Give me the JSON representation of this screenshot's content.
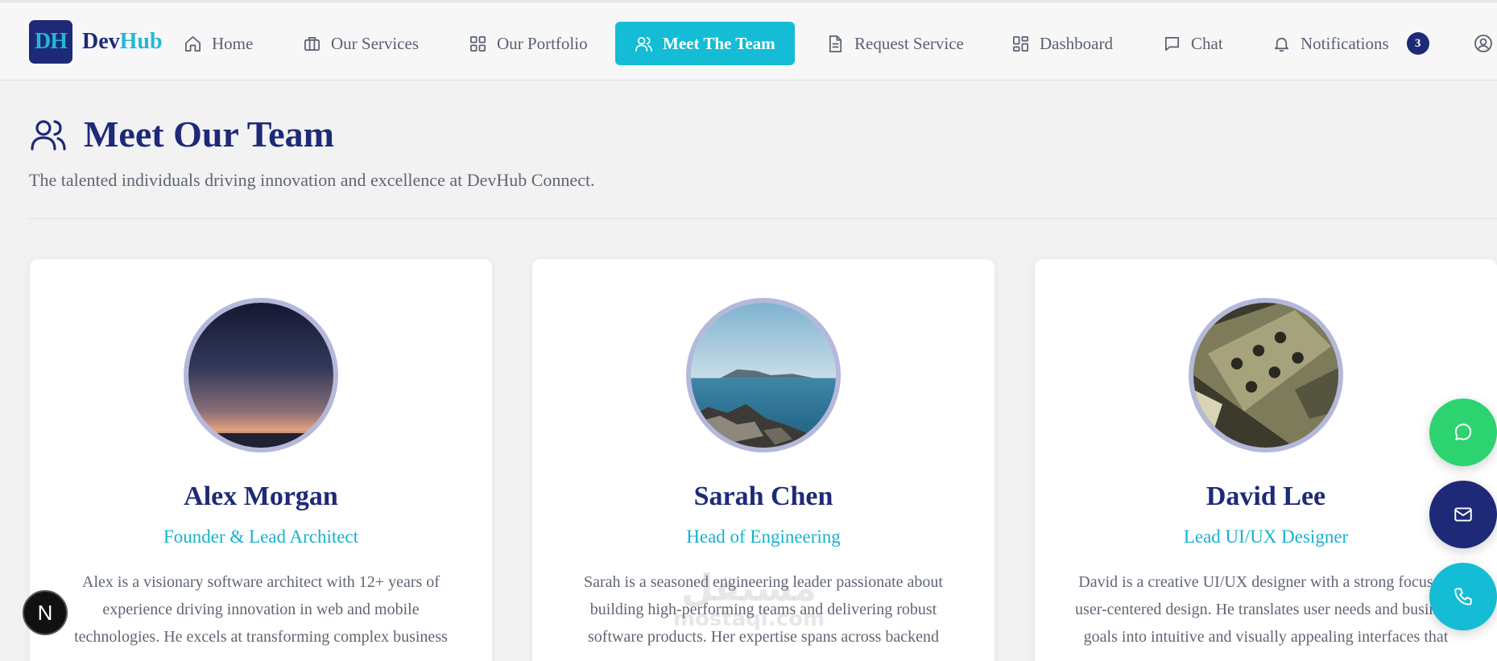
{
  "brand": {
    "mark": "DH",
    "name_part1": "Dev",
    "name_part2": "Hub"
  },
  "nav": {
    "items": [
      {
        "label": "Home",
        "icon": "home-icon"
      },
      {
        "label": "Our Services",
        "icon": "briefcase-icon"
      },
      {
        "label": "Our Portfolio",
        "icon": "grid-icon"
      },
      {
        "label": "Meet The Team",
        "icon": "users-icon",
        "active": true
      },
      {
        "label": "Request Service",
        "icon": "document-icon"
      },
      {
        "label": "Dashboard",
        "icon": "dashboard-icon"
      },
      {
        "label": "Chat",
        "icon": "chat-icon"
      },
      {
        "label": "Notifications",
        "icon": "bell-icon",
        "badge": "3"
      }
    ],
    "user_icon": "user-circle-icon"
  },
  "page": {
    "title": "Meet Our Team",
    "subtitle": "The talented individuals driving innovation and excellence at DevHub Connect."
  },
  "team": [
    {
      "name": "Alex Morgan",
      "role": "Founder & Lead Architect",
      "bio": "Alex is a visionary software architect with 12+ years of experience driving innovation in web and mobile technologies. He excels at transforming complex business",
      "photo": "sunset-photo"
    },
    {
      "name": "Sarah Chen",
      "role": "Head of Engineering",
      "bio": "Sarah is a seasoned engineering leader passionate about building high-performing teams and delivering robust software products. Her expertise spans across backend",
      "photo": "sea-photo"
    },
    {
      "name": "David Lee",
      "role": "Lead UI/UX Designer",
      "bio": "David is a creative UI/UX designer with a strong focus on user-centered design. He translates user needs and business goals into intuitive and visually appealing interfaces that",
      "photo": "guitar-photo"
    }
  ],
  "floating": {
    "whatsapp_icon": "whatsapp-icon",
    "email_icon": "mail-icon",
    "phone_icon": "phone-icon"
  },
  "next_badge": {
    "label": "N"
  },
  "watermark": {
    "arabic": "مستقل",
    "latin": "mostaql.com"
  },
  "colors": {
    "primary": "#1e2a78",
    "accent": "#14bcd6",
    "whatsapp": "#2dd36f",
    "text_muted": "#5f6673"
  }
}
